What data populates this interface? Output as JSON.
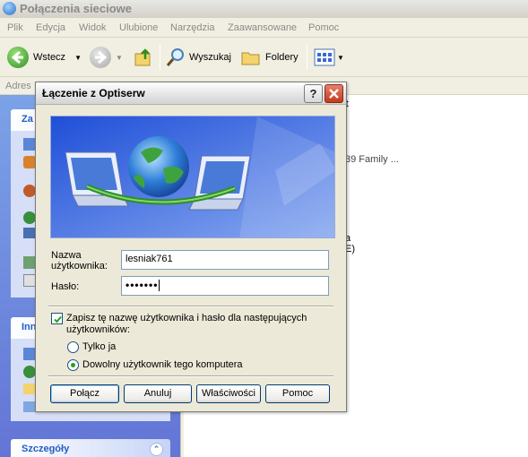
{
  "background_window": {
    "title": "Połączenia sieciowe",
    "menu": [
      "Plik",
      "Edycja",
      "Widok",
      "Ulubione",
      "Narzędzia",
      "Zaawansowane",
      "Pomoc"
    ],
    "toolbar": {
      "back_label": "Wstecz",
      "search_label": "Wyszukaj",
      "folders_label": "Foldery"
    },
    "address_label": "Adres",
    "left_panel": {
      "section1_title": "Za",
      "section2_title": "Inn",
      "details_title": "Szczegóły"
    },
    "right_fragments": {
      "t": "t",
      "family": "39 Family ...",
      "a": "a",
      "e": "E)"
    }
  },
  "dialog": {
    "title": "Łączenie z Optiserw",
    "username_label": "Nazwa\nużytkownika:",
    "username_value": "lesniak761",
    "password_label": "Hasło:",
    "password_value": "•••••••",
    "save_checkbox_label": "Zapisz tę nazwę użytkownika i hasło dla następujących użytkowników:",
    "save_checked": true,
    "radio_only_me": "Tylko ja",
    "radio_anyone": "Dowolny użytkownik tego komputera",
    "selected_radio": "anyone",
    "buttons": {
      "connect": "Połącz",
      "cancel": "Anuluj",
      "properties": "Właściwości",
      "help": "Pomoc"
    }
  },
  "colors": {
    "xp_blue": "#215dc6",
    "close_red": "#c4391d",
    "dialog_face": "#ece9d8"
  }
}
